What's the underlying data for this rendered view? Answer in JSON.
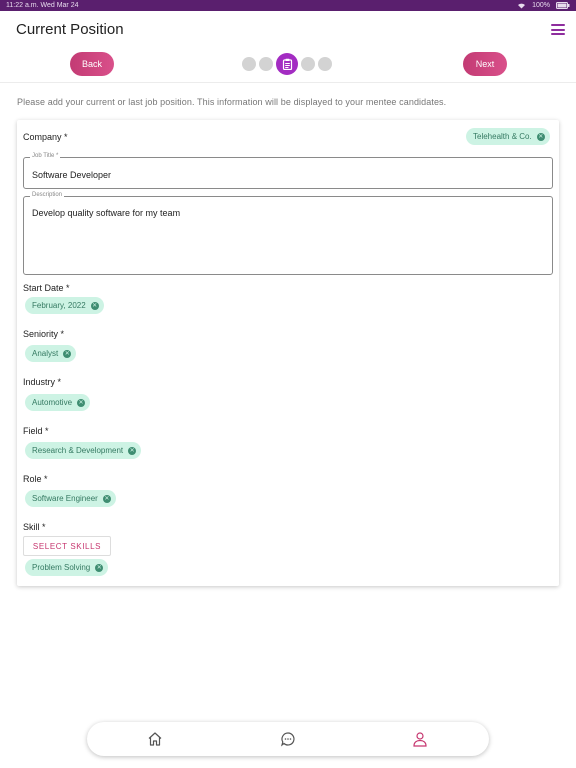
{
  "status_bar": {
    "left": "11:22 a.m.  Wed Mar 24",
    "right": "100%"
  },
  "header": {
    "title": "Current Position"
  },
  "nav": {
    "back_label": "Back",
    "next_label": "Next"
  },
  "intro": "Please add your current or last job position. This information will be displayed to your mentee candidates.",
  "form": {
    "company": {
      "label": "Company *",
      "chip": "Telehealth & Co."
    },
    "job_title": {
      "label": "Job Title *",
      "value": "Software Developer"
    },
    "description": {
      "label": "Description",
      "value": "Develop quality software for my team"
    },
    "start_date": {
      "label": "Start Date *",
      "chip": "February, 2022"
    },
    "seniority": {
      "label": "Seniority *",
      "chip": "Analyst"
    },
    "industry": {
      "label": "Industry *",
      "chip": "Automotive"
    },
    "field": {
      "label": "Field *",
      "chip": "Research & Development"
    },
    "role": {
      "label": "Role *",
      "chip": "Software Engineer"
    },
    "skill": {
      "label": "Skill *",
      "button": "SELECT SKILLS",
      "chip": "Problem Solving"
    }
  },
  "colors": {
    "accent": "#c33b74",
    "step_active": "#a32cc2",
    "chip_bg": "#cdf3e4",
    "chip_text": "#357a62",
    "status_bar": "#5a1f6e"
  },
  "icons": [
    "menu-icon",
    "clipboard-icon",
    "home-icon",
    "chat-icon",
    "profile-icon",
    "close-icon"
  ]
}
